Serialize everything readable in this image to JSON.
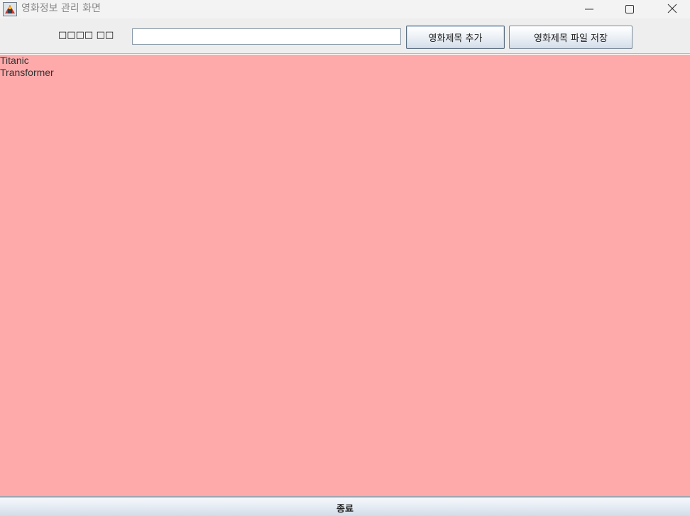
{
  "window": {
    "title": "영화정보 관리 화면",
    "icon": "java-app-icon"
  },
  "controls": {
    "minimize_icon": "minimize-icon",
    "maximize_icon": "maximize-icon",
    "close_icon": "close-icon"
  },
  "top_panel": {
    "label": "□□□□ □□",
    "input_value": "",
    "add_button": "영화제목 추가",
    "save_button": "영화제목 파일 저장"
  },
  "movie_list": {
    "background_color": "#ffaaaa",
    "items": [
      "Titanic",
      "Transformer"
    ]
  },
  "bottom": {
    "exit_button": "종료"
  }
}
